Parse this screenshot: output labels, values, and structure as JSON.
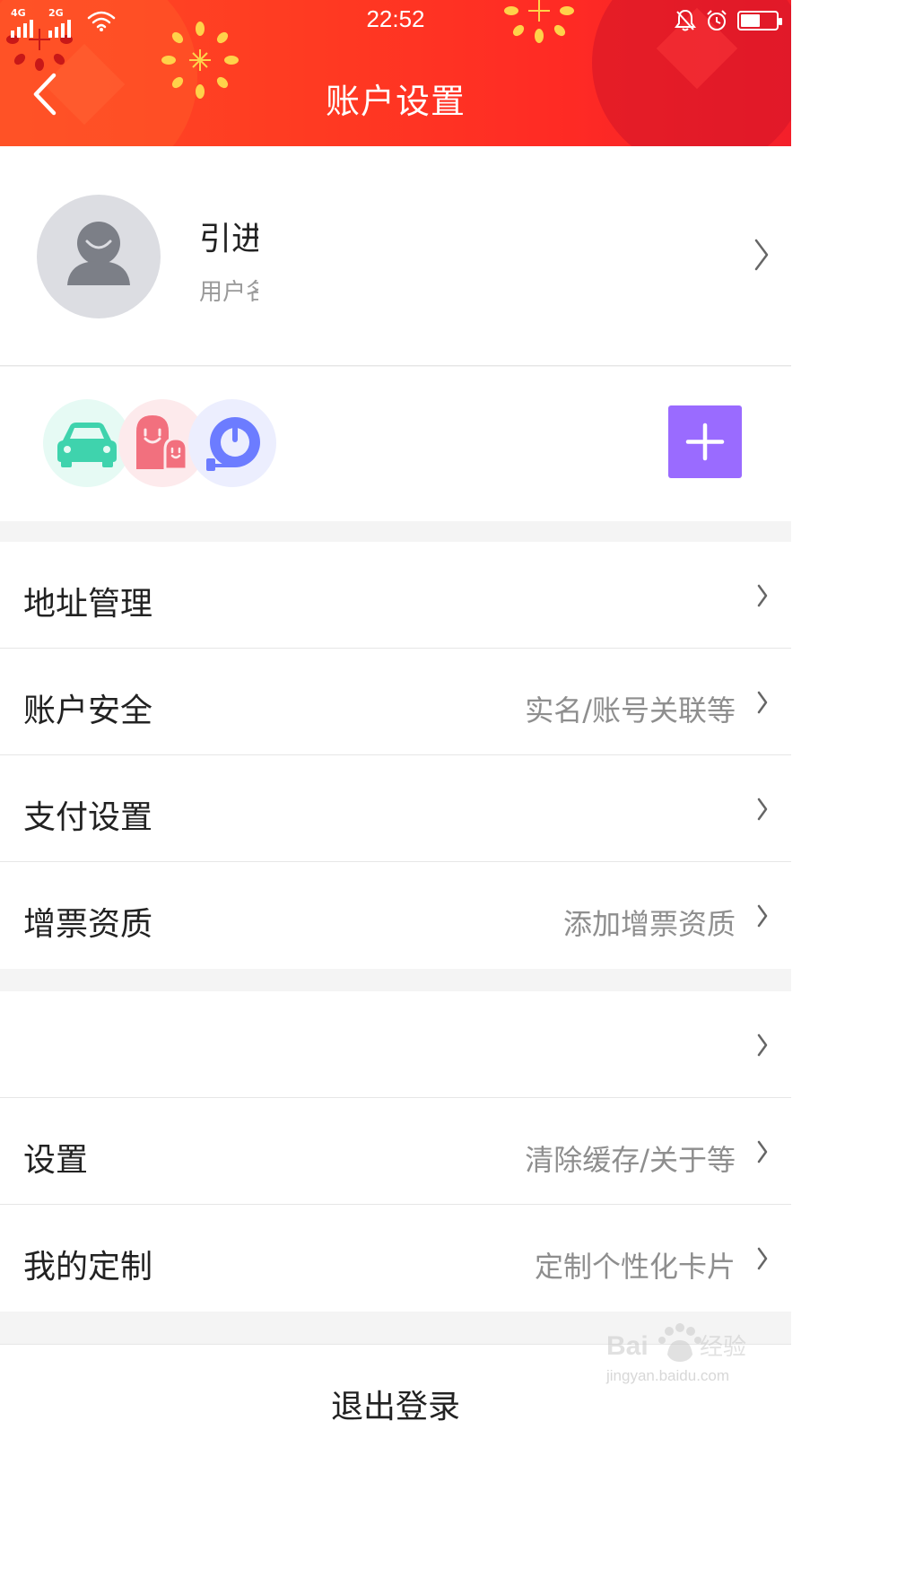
{
  "status_bar": {
    "network_left": "4G",
    "network_right": "2G",
    "time": "22:52",
    "battery_level": 0.55
  },
  "header": {
    "title": "账户设置",
    "back_icon": "chevron-left-icon"
  },
  "profile": {
    "name": "引进",
    "subtitle": "用户名",
    "avatar_icon": "default-avatar-icon"
  },
  "apps": {
    "items": [
      {
        "icon": "car-icon",
        "color": "#3fd3ad",
        "bg": "#e6faf4"
      },
      {
        "icon": "family-icon",
        "color": "#f2707e",
        "bg": "#fdeaec"
      },
      {
        "icon": "tape-measure-icon",
        "color": "#6c7cff",
        "bg": "#eceefe"
      }
    ],
    "add_icon": "plus-icon",
    "add_color": "#9a6bff"
  },
  "group1": [
    {
      "label": "地址管理",
      "value": ""
    },
    {
      "label": "账户安全",
      "value": "实名/账号关联等"
    },
    {
      "label": "支付设置",
      "value": ""
    },
    {
      "label": "增票资质",
      "value": "添加增票资质"
    }
  ],
  "group2": [
    {
      "label": "",
      "value": ""
    },
    {
      "label": "设置",
      "value": "清除缓存/关于等"
    },
    {
      "label": "我的定制",
      "value": "定制个性化卡片"
    }
  ],
  "logout": {
    "label": "退出登录"
  },
  "watermark": {
    "text": "jingyan.baidu.com",
    "logo_text": "Baidu经验"
  },
  "colors": {
    "header_red": "#ff3a22",
    "accent_purple": "#9a6bff",
    "text_secondary": "#8e8e8e",
    "background": "#f4f4f4"
  }
}
